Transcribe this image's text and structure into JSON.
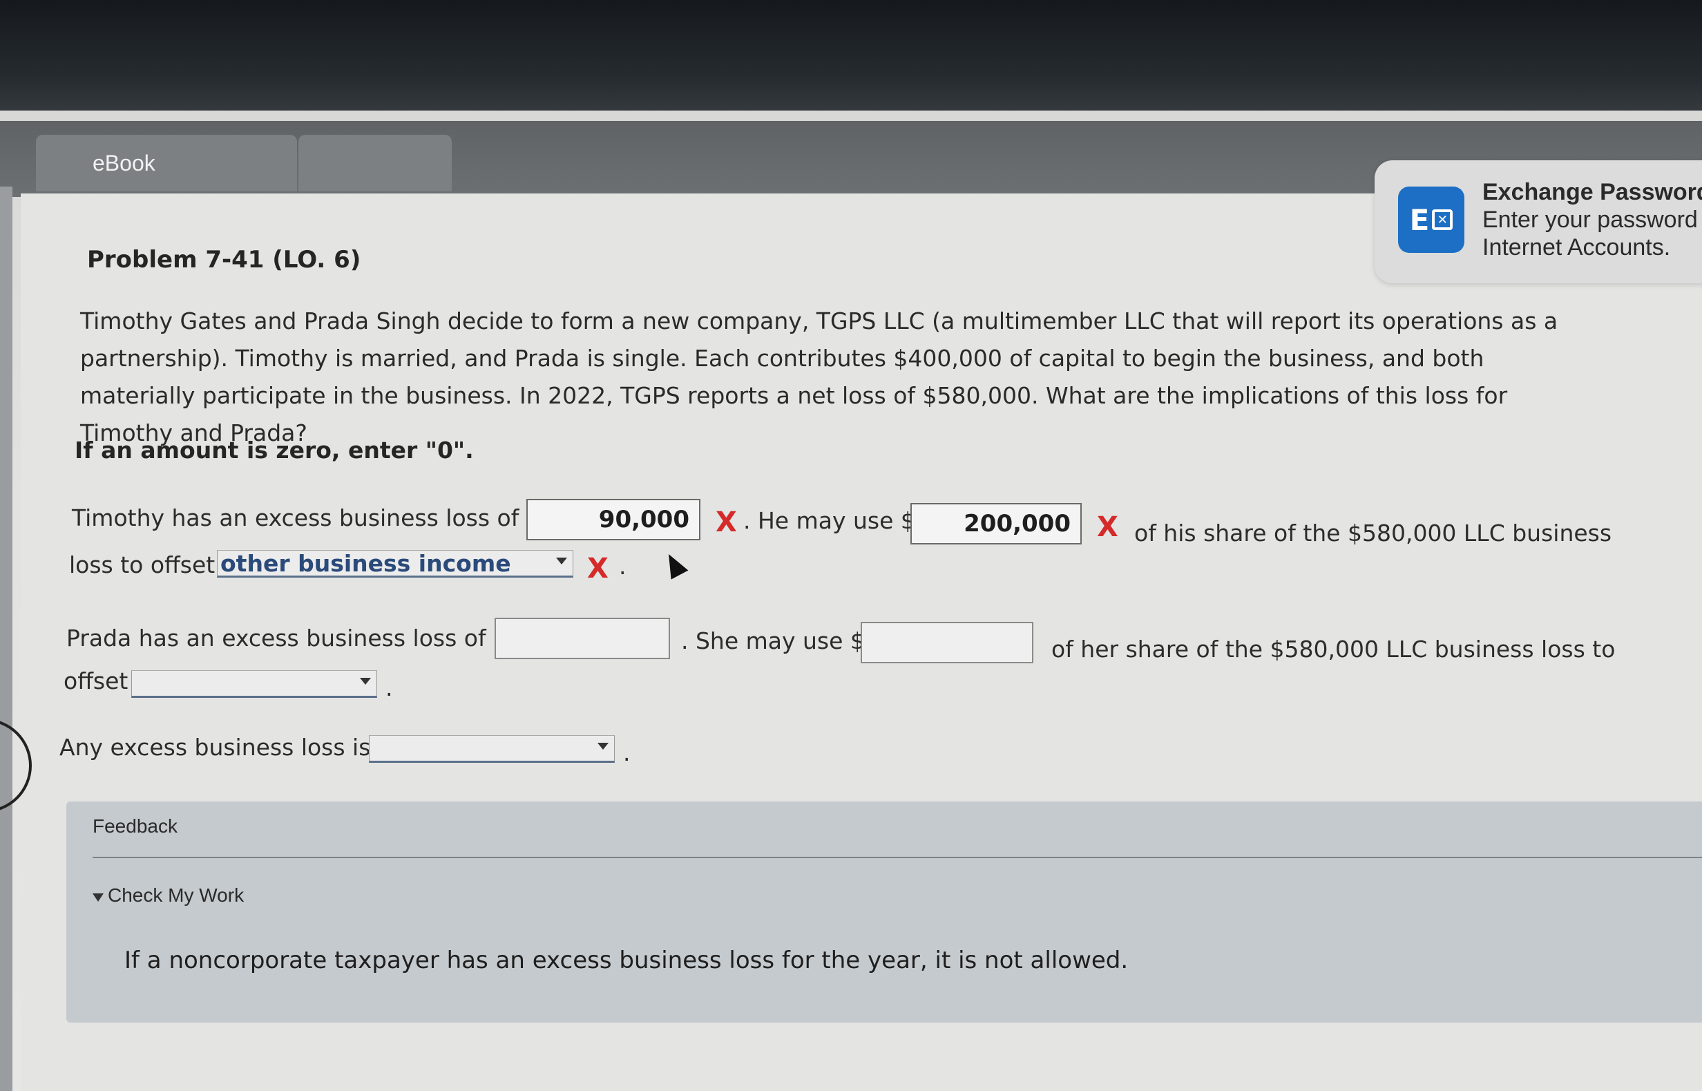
{
  "tabs": [
    {
      "label": "eBook"
    },
    {
      "label": ""
    }
  ],
  "notification": {
    "title": "Exchange Password",
    "line1": "Enter your password",
    "line2": "Internet Accounts.",
    "icon": "exchange-icon"
  },
  "problem": {
    "title": "Problem 7-41 (LO. 6)",
    "paragraph": "Timothy Gates and Prada Singh decide to form a new company, TGPS LLC (a multimember LLC that will report its operations as a partnership). Timothy is married, and Prada is single. Each contributes $400,000 of capital to begin the business, and both materially participate in the business. In 2022, TGPS reports a net loss of $580,000. What are the implications of this loss for Timothy and Prada?",
    "zero_note": "If an amount is zero, enter \"0\"."
  },
  "timothy": {
    "text1": "Timothy has an excess business loss of $",
    "excess_loss_value": "90,000",
    "text2": ". He may use $",
    "use_value": "200,000",
    "text3": "of his share of the $580,000 LLC business",
    "text4": "loss to offset",
    "offset_selected": "other business income",
    "end": "."
  },
  "prada": {
    "text1": "Prada has an excess business loss of $",
    "excess_loss_value": "",
    "text2": ". She may use $",
    "use_value": "",
    "text3": "of her share of the $580,000 LLC business loss to",
    "text4": "offset",
    "offset_selected": "",
    "end": "."
  },
  "any_excess": {
    "text": "Any excess business loss is",
    "selected": "",
    "end": "."
  },
  "status": {
    "incorrect_mark": "X",
    "incorrect_color": "#d42a2a"
  },
  "feedback": {
    "title": "Feedback",
    "toggle_label": "Check My Work",
    "body": "If a noncorporate taxpayer has an excess business loss for the year, it is not allowed."
  }
}
